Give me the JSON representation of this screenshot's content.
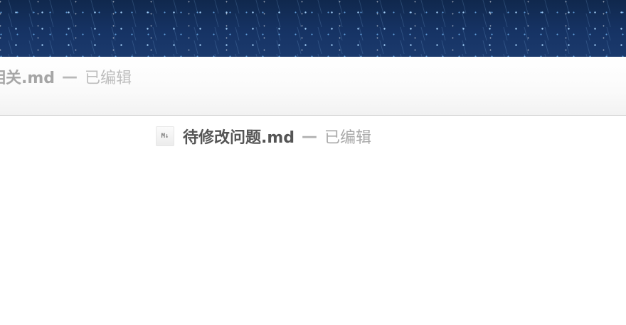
{
  "back_window": {
    "file_name": "相关.md",
    "separator": "—",
    "status": "已编辑"
  },
  "front_window": {
    "icon": "markdown-file-icon",
    "icon_glyph": "M↓",
    "file_name": "待修改问题.md",
    "separator": "—",
    "status": "已编辑"
  }
}
